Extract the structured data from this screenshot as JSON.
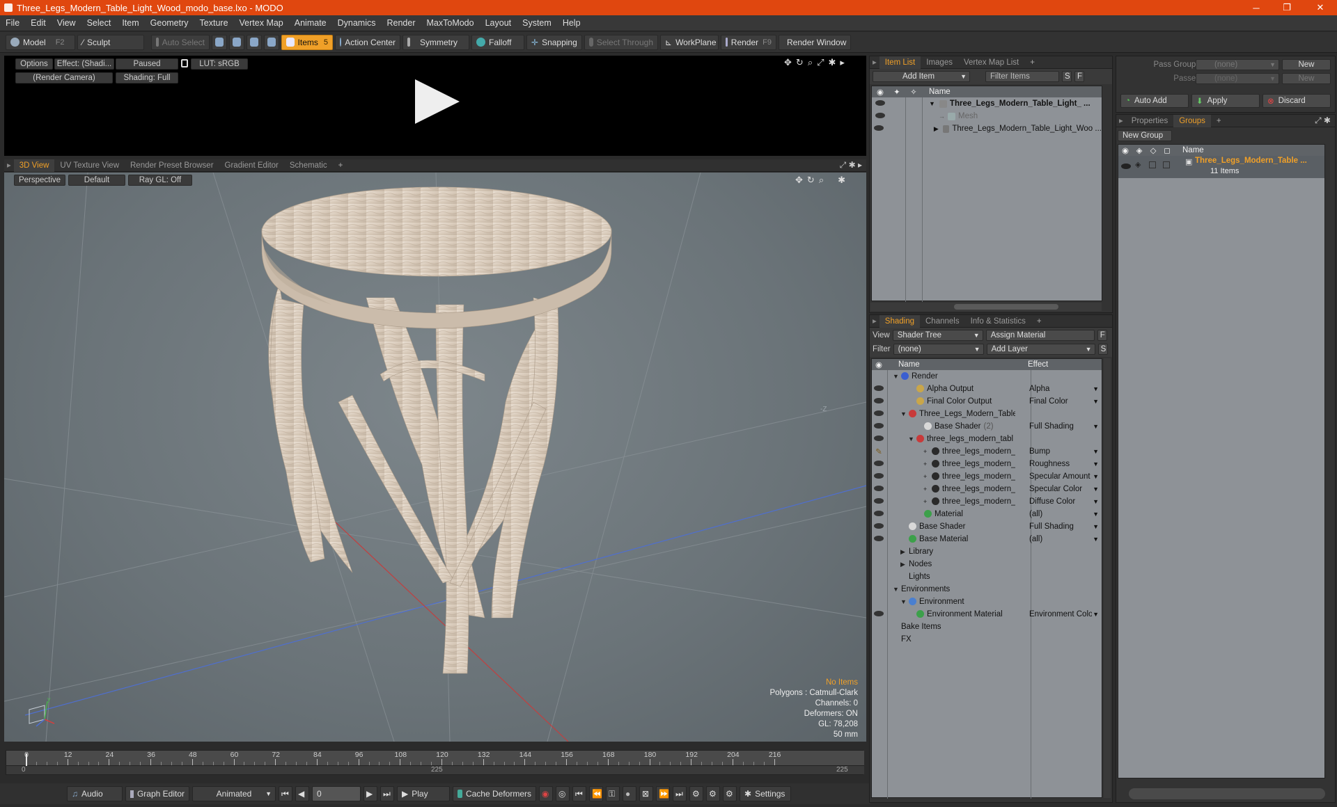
{
  "window": {
    "title": "Three_Legs_Modern_Table_Light_Wood_modo_base.lxo - MODO",
    "minimize": "─",
    "maximize": "❐",
    "close": "✕"
  },
  "menu": [
    "File",
    "Edit",
    "View",
    "Select",
    "Item",
    "Geometry",
    "Texture",
    "Vertex Map",
    "Animate",
    "Dynamics",
    "Render",
    "MaxToModo",
    "Layout",
    "System",
    "Help"
  ],
  "toolbar": {
    "model": "Model",
    "model_key": "F2",
    "sculpt": "Sculpt",
    "auto_select": "Auto Select",
    "items": "Items",
    "items_key": "5",
    "action_center": "Action Center",
    "symmetry": "Symmetry",
    "falloff": "Falloff",
    "snapping": "Snapping",
    "select_through": "Select Through",
    "workplane": "WorkPlane",
    "render": "Render",
    "render_key": "F9",
    "render_window": "Render Window"
  },
  "render_view": {
    "options": "Options",
    "effect": "Effect: (Shadi...",
    "paused": "Paused",
    "lut": "LUT: sRGB",
    "camera": "(Render Camera)",
    "shading": "Shading: Full"
  },
  "view_tabs": [
    "3D View",
    "UV Texture View",
    "Render Preset Browser",
    "Gradient Editor",
    "Schematic",
    "+"
  ],
  "viewport": {
    "perspective": "Perspective",
    "default": "Default",
    "raygl": "Ray GL: Off",
    "z_label": "-Z",
    "info": {
      "no_items": "No Items",
      "polygons": "Polygons : Catmull-Clark",
      "channels": "Channels: 0",
      "deformers": "Deformers: ON",
      "gl": "GL: 78,208",
      "scale": "50 mm"
    }
  },
  "timeline": {
    "ticks": [
      "0",
      "12",
      "24",
      "36",
      "48",
      "60",
      "72",
      "84",
      "96",
      "108",
      "120",
      "132",
      "144",
      "156",
      "168",
      "180",
      "192",
      "204",
      "216"
    ],
    "start": "0",
    "mid": "225",
    "end": "225"
  },
  "bottombar": {
    "audio": "Audio",
    "graph_editor": "Graph Editor",
    "animated": "Animated",
    "frame": "0",
    "play": "Play",
    "cache_deformers": "Cache Deformers",
    "settings": "Settings"
  },
  "item_list": {
    "tabs": [
      "Item List",
      "Images",
      "Vertex Map List",
      "+"
    ],
    "add_item": "Add Item",
    "filter_items": "Filter Items",
    "s_btn": "S",
    "f_btn": "F",
    "name_col": "Name",
    "rows": [
      {
        "label": "Three_Legs_Modern_Table_Light_ ...",
        "bold": true
      },
      {
        "label": "Mesh",
        "dim": true
      },
      {
        "label": "Three_Legs_Modern_Table_Light_Woo ..."
      }
    ]
  },
  "shading": {
    "tabs": [
      "Shading",
      "Channels",
      "Info & Statistics",
      "+"
    ],
    "view_label": "View",
    "view_value": "Shader Tree",
    "assign_material": "Assign Material",
    "f_btn": "F",
    "filter_label": "Filter",
    "filter_value": "(none)",
    "add_layer": "Add Layer",
    "s_btn": "S",
    "name_col": "Name",
    "effect_col": "Effect",
    "rows": [
      {
        "name": "Render",
        "effect": "",
        "indent": 0,
        "ball": "#3b5fd0",
        "eye": false,
        "arrow": "▼"
      },
      {
        "name": "Alpha Output",
        "effect": "Alpha",
        "indent": 2,
        "ball": "#c9a64a",
        "eye": true,
        "arrow": ""
      },
      {
        "name": "Final Color Output",
        "effect": "Final Color",
        "indent": 2,
        "ball": "#c9a64a",
        "eye": true,
        "arrow": ""
      },
      {
        "name": "Three_Legs_Modern_Table ...",
        "effect": "",
        "indent": 1,
        "ball": "#c83a3a",
        "eye": true,
        "arrow": "▼"
      },
      {
        "name": "Base Shader",
        "suffix": "(2)",
        "effect": "Full Shading",
        "indent": 3,
        "ball": "#d8d8d8",
        "eye": true,
        "arrow": ""
      },
      {
        "name": "three_legs_modern_tabl ...",
        "effect": "",
        "indent": 2,
        "ball": "#c83a3a",
        "eye": true,
        "arrow": "▼"
      },
      {
        "name": "three_legs_modern_ta...",
        "effect": "Bump",
        "indent": 4,
        "ball": "#2a2a2a",
        "eye": false,
        "brush": true,
        "arrow": "+"
      },
      {
        "name": "three_legs_modern_ta...",
        "effect": "Roughness",
        "indent": 4,
        "ball": "#2a2a2a",
        "eye": true,
        "arrow": "+"
      },
      {
        "name": "three_legs_modern_ta...",
        "effect": "Specular Amount",
        "indent": 4,
        "ball": "#2a2a2a",
        "eye": true,
        "arrow": "+"
      },
      {
        "name": "three_legs_modern_ta...",
        "effect": "Specular Color",
        "indent": 4,
        "ball": "#2a2a2a",
        "eye": true,
        "arrow": "+"
      },
      {
        "name": "three_legs_modern_ta...",
        "effect": "Diffuse Color",
        "indent": 4,
        "ball": "#2a2a2a",
        "eye": true,
        "arrow": "+"
      },
      {
        "name": "Material",
        "effect": "(all)",
        "indent": 3,
        "ball": "#3ca04a",
        "eye": true,
        "arrow": ""
      },
      {
        "name": "Base Shader",
        "effect": "Full Shading",
        "indent": 1,
        "ball": "#d8d8d8",
        "eye": true,
        "arrow": ""
      },
      {
        "name": "Base Material",
        "effect": "(all)",
        "indent": 1,
        "ball": "#3ca04a",
        "eye": true,
        "arrow": ""
      },
      {
        "name": "Library",
        "effect": "",
        "indent": 1,
        "ball": "",
        "eye": false,
        "arrow": "▶"
      },
      {
        "name": "Nodes",
        "effect": "",
        "indent": 1,
        "ball": "",
        "eye": false,
        "arrow": "▶"
      },
      {
        "name": "Lights",
        "effect": "",
        "indent": 1,
        "ball": "",
        "eye": false,
        "arrow": ""
      },
      {
        "name": "Environments",
        "effect": "",
        "indent": 0,
        "ball": "",
        "eye": false,
        "arrow": "▼"
      },
      {
        "name": "Environment",
        "effect": "",
        "indent": 1,
        "ball": "#4a7fd0",
        "eye": false,
        "arrow": "▼"
      },
      {
        "name": "Environment Material",
        "effect": "Environment Color",
        "indent": 2,
        "ball": "#3ca04a",
        "eye": true,
        "arrow": ""
      },
      {
        "name": "Bake Items",
        "effect": "",
        "indent": 0,
        "ball": "",
        "eye": false,
        "arrow": ""
      },
      {
        "name": "FX",
        "effect": "",
        "indent": 0,
        "ball": "",
        "eye": false,
        "arrow": ""
      }
    ]
  },
  "passes": {
    "pass_groups_label": "Pass Groups",
    "pass_groups_value": "(none)",
    "passes_label": "Passes",
    "passes_value": "(none)",
    "new": "New",
    "new2": "New",
    "auto_add": "Auto Add",
    "apply": "Apply",
    "discard": "Discard"
  },
  "groups": {
    "tabs": [
      "Properties",
      "Groups",
      "+"
    ],
    "new_group": "New Group",
    "name_col": "Name",
    "item_name": "Three_Legs_Modern_Table ...",
    "item_count": "11 Items"
  }
}
